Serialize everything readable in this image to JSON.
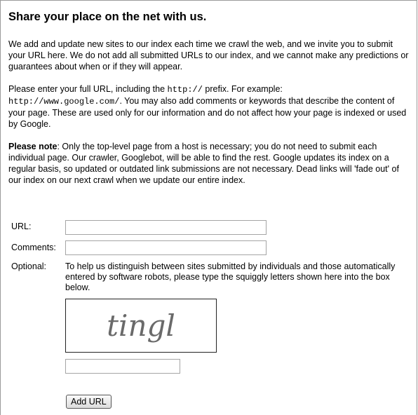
{
  "heading": "Share your place on the net with us.",
  "intro": "We add and update new sites to our index each time we crawl the web, and we invite you to submit your URL here. We do not add all submitted URLs to our index, and we cannot make any predictions or guarantees about when or if they will appear.",
  "instructions": {
    "before_prefix": "Please enter your full URL, including the ",
    "prefix": "http://",
    "after_prefix": " prefix. For example:",
    "example": "http://www.google.com/",
    "after_example": ". You may also add comments or keywords that describe the content of your page. These are used only for our information and do not affect how your page is indexed or used by Google."
  },
  "note": {
    "label": "Please note",
    "text": ": Only the top-level page from a host is necessary; you do not need to submit each individual page. Our crawler, Googlebot, will be able to find the rest. Google updates its index on a regular basis, so updated or outdated link submissions are not necessary. Dead links will 'fade out' of our index on our next crawl when we update our entire index."
  },
  "form": {
    "url_label": "URL:",
    "url_value": "",
    "comments_label": "Comments:",
    "comments_value": "",
    "optional_label": "Optional:",
    "optional_text": "To help us distinguish between sites submitted by individuals and those automatically entered by software robots, please type the squiggly letters shown here into the box below.",
    "captcha_text": "tingl",
    "captcha_value": "",
    "submit_label": "Add URL"
  }
}
